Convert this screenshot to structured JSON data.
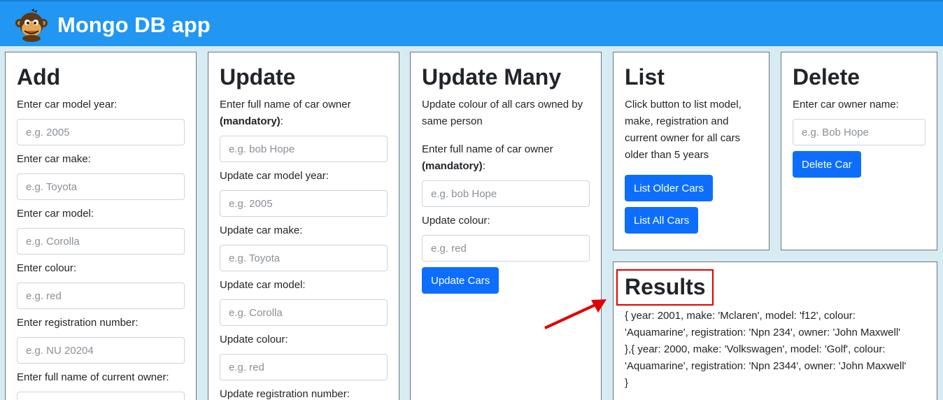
{
  "app": {
    "title": "Mongo DB app"
  },
  "add": {
    "heading": "Add",
    "year_label": "Enter car model year:",
    "year_placeholder": "e.g. 2005",
    "make_label": "Enter car make:",
    "make_placeholder": "e.g. Toyota",
    "model_label": "Enter car model:",
    "model_placeholder": "e.g. Corolla",
    "colour_label": "Enter colour:",
    "colour_placeholder": "e.g. red",
    "reg_label": "Enter registration number:",
    "reg_placeholder": "e.g. NU 20204",
    "owner_label": "Enter full name of current owner:"
  },
  "update": {
    "heading": "Update",
    "owner_label": "Enter full name of car owner",
    "owner_mandatory": "(mandatory)",
    "owner_suffix": ":",
    "owner_placeholder": "e.g. bob Hope",
    "year_label": "Update car model year:",
    "year_placeholder": "e.g. 2005",
    "make_label": "Update car make:",
    "make_placeholder": "e.g. Toyota",
    "model_label": "Update car model:",
    "model_placeholder": "e.g. Corolla",
    "colour_label": "Update colour:",
    "colour_placeholder": "e.g. red",
    "reg_label": "Update registration number:"
  },
  "update_many": {
    "heading": "Update Many",
    "description": "Update colour of all cars owned by same person",
    "owner_label": "Enter full name of car owner",
    "owner_mandatory": "(mandatory)",
    "owner_suffix": ":",
    "owner_placeholder": "e.g. bob Hope",
    "colour_label": "Update colour:",
    "colour_placeholder": "e.g. red",
    "button": "Update Cars"
  },
  "list": {
    "heading": "List",
    "description": "Click button to list model, make, registration and current owner for all cars older than 5 years",
    "older_button": "List Older Cars",
    "all_button": "List All Cars"
  },
  "delete": {
    "heading": "Delete",
    "owner_label": "Enter car owner name:",
    "owner_placeholder": "e.g. Bob Hope",
    "button": "Delete Car"
  },
  "results": {
    "heading": "Results",
    "lines": [
      "{ year: 2001, make: 'Mclaren', model: 'f12', colour:",
      "'Aquamarine', registration: 'Npn 234', owner: 'John Maxwell'",
      "},{ year: 2000, make: 'Volkswagen', model: 'Golf', colour:",
      "'Aquamarine', registration: 'Npn 2344', owner: 'John Maxwell'",
      "}"
    ]
  },
  "colors": {
    "navbar": "#2196f3",
    "button": "#0d6efd",
    "highlight": "#e00000",
    "background": "#d6ebf2"
  }
}
